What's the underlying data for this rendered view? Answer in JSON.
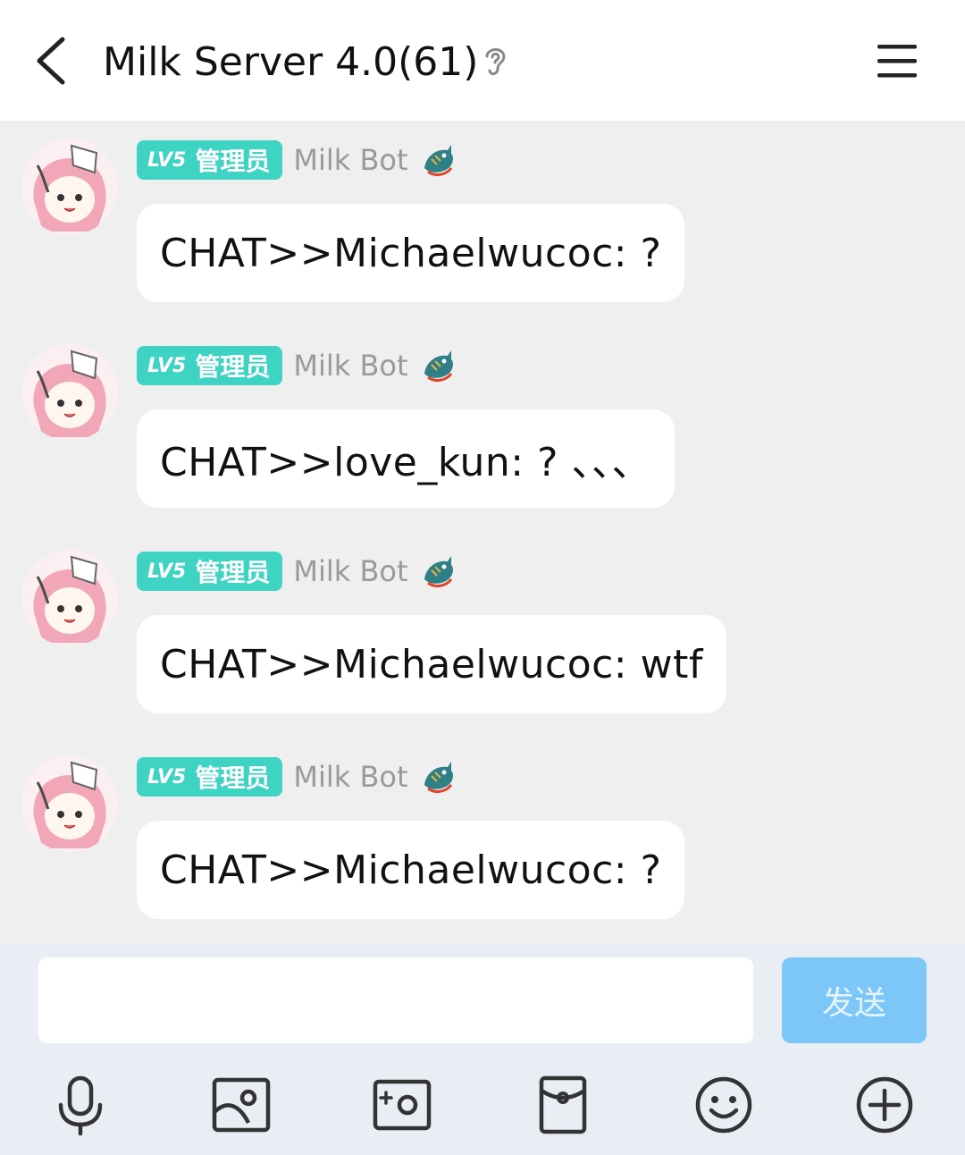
{
  "header": {
    "title": "Milk Server 4.0(61)"
  },
  "messages": [
    {
      "level": "LV5",
      "role": "管理员",
      "sender": "Milk Bot",
      "text": "CHAT>>Michaelwucoc: ?"
    },
    {
      "level": "LV5",
      "role": "管理员",
      "sender": "Milk Bot",
      "text": "CHAT>>love_kun: ? 、、、"
    },
    {
      "level": "LV5",
      "role": "管理员",
      "sender": "Milk Bot",
      "text": "CHAT>>Michaelwucoc: wtf"
    },
    {
      "level": "LV5",
      "role": "管理员",
      "sender": "Milk Bot",
      "text": "CHAT>>Michaelwucoc: ?"
    }
  ],
  "input": {
    "value": "",
    "send_label": "发送"
  },
  "toolbar": {
    "icons": [
      "microphone-icon",
      "image-icon",
      "camera-icon",
      "red-packet-icon",
      "emoji-icon",
      "plus-icon"
    ]
  },
  "colors": {
    "badge": "#3fd3c4",
    "send_button": "#7cc7f7",
    "background": "#efeff0"
  }
}
